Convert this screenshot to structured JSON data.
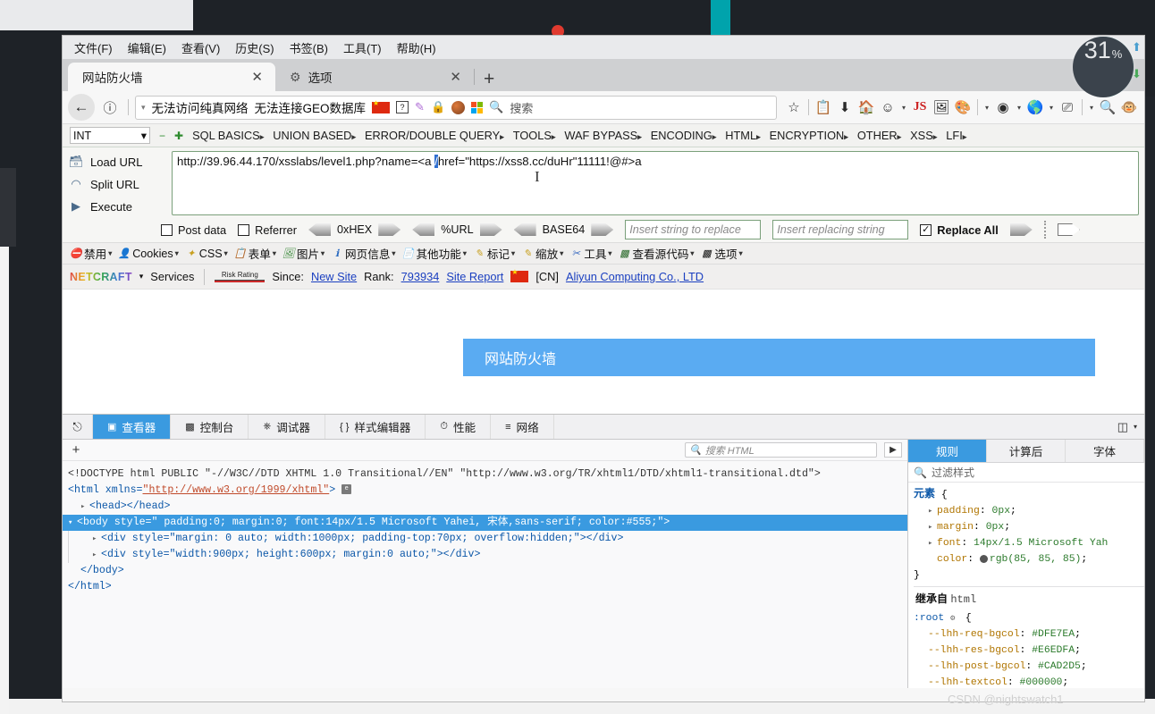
{
  "desktop": {
    "zoom_badge": {
      "value": "31",
      "unit": "%"
    },
    "watermark": "CSDN @nightswatch1"
  },
  "menubar": [
    {
      "label": "文件(F)"
    },
    {
      "label": "编辑(E)"
    },
    {
      "label": "查看(V)"
    },
    {
      "label": "历史(S)"
    },
    {
      "label": "书签(B)"
    },
    {
      "label": "工具(T)"
    },
    {
      "label": "帮助(H)"
    }
  ],
  "tabs": {
    "active": {
      "title": "网站防火墙",
      "close": "✕"
    },
    "second": {
      "title": "选项",
      "close": "✕",
      "icon": "gear-icon"
    },
    "new_tab": "+"
  },
  "navbar": {
    "back": "←",
    "info_icon": "ⓘ",
    "dropdown_caret": "▾",
    "status_text_1": "无法访问纯真网络",
    "status_text_2": "无法连接GEO数据库",
    "search_placeholder": "搜索",
    "icons": [
      "flag-cn-icon",
      "unknown-icon",
      "pen-icon",
      "lock-icon",
      "globe-icon",
      "microsoft-icon",
      "search-icon"
    ],
    "right_icons": [
      "bookmark-star-icon",
      "library-icon",
      "download-icon",
      "home-icon",
      "account-icon",
      "js-icon",
      "screenshot-icon",
      "palette-icon",
      "hackbar-icon",
      "firefox-icon",
      "container-icon",
      "zoom-icon",
      "monkey-icon"
    ]
  },
  "hackbar": {
    "select_value": "INT",
    "minus": "−",
    "plus": "✚",
    "menus": [
      {
        "label": "SQL BASICS"
      },
      {
        "label": "UNION BASED"
      },
      {
        "label": "ERROR/DOUBLE QUERY"
      },
      {
        "label": "TOOLS"
      },
      {
        "label": "WAF BYPASS"
      },
      {
        "label": "ENCODING"
      },
      {
        "label": "HTML"
      },
      {
        "label": "ENCRYPTION"
      },
      {
        "label": "OTHER"
      },
      {
        "label": "XSS"
      },
      {
        "label": "LFI"
      }
    ],
    "actions": [
      {
        "label": "Load URL",
        "icon": "load-icon"
      },
      {
        "label": "Split URL",
        "icon": "split-icon"
      },
      {
        "label": "Execute",
        "icon": "execute-icon"
      }
    ],
    "url_before": "http://39.96.44.170/xsslabs/level1.php?name=<a ",
    "url_selected": "/",
    "url_after": "href=\"https://xss8.cc/duHr\"11111!@#>a",
    "options": {
      "post_data": "Post data",
      "referrer": "Referrer",
      "hex": "0xHEX",
      "url_enc": "%URL",
      "base64": "BASE64",
      "replace_search_placeholder": "Insert string to replace",
      "replace_with_placeholder": "Insert replacing string",
      "replace_all": "Replace All",
      "checked_mark": "✓"
    }
  },
  "webdev_toolbar": [
    {
      "label": "禁用",
      "icon": "disable-icon"
    },
    {
      "label": "Cookies",
      "icon": "cookie-icon"
    },
    {
      "label": "CSS",
      "icon": "css-icon"
    },
    {
      "label": "表单",
      "icon": "form-icon"
    },
    {
      "label": "图片",
      "icon": "image-icon"
    },
    {
      "label": "网页信息",
      "icon": "info-icon"
    },
    {
      "label": "其他功能",
      "icon": "misc-icon"
    },
    {
      "label": "标记",
      "icon": "outline-icon"
    },
    {
      "label": "缩放",
      "icon": "resize-icon"
    },
    {
      "label": "工具",
      "icon": "tools-icon"
    },
    {
      "label": "查看源代码",
      "icon": "source-icon"
    },
    {
      "label": "选项",
      "icon": "options-icon"
    }
  ],
  "netcraft": {
    "logo": "NETCRAFT",
    "services": "Services",
    "risk_rating": "Risk Rating",
    "since_label": "Since:",
    "since_value": "New Site",
    "rank_label": "Rank:",
    "rank_value": "793934",
    "site_report": "Site Report",
    "country": "[CN]",
    "host": "Aliyun Computing Co., LTD"
  },
  "page": {
    "banner_title": "网站防火墙"
  },
  "devtools": {
    "tabs": [
      {
        "label": "查看器",
        "icon": "inspector-icon",
        "active": true
      },
      {
        "label": "控制台",
        "icon": "console-icon",
        "active": false
      },
      {
        "label": "调试器",
        "icon": "debugger-icon",
        "active": false
      },
      {
        "label": "样式编辑器",
        "icon": "style-editor-icon",
        "active": false
      },
      {
        "label": "性能",
        "icon": "performance-icon",
        "active": false
      },
      {
        "label": "网络",
        "icon": "network-icon",
        "active": false
      }
    ],
    "picker_icon": "element-picker-icon",
    "layout_icon": "panel-layout-icon",
    "add_node": "+",
    "search_placeholder": "搜索 HTML",
    "markup": {
      "doctype": "<!DOCTYPE html PUBLIC \"-//W3C//DTD XHTML 1.0 Transitional//EN\" \"http://www.w3.org/TR/xhtml1/DTD/xhtml1-transitional.dtd\">",
      "html_open_a": "<html xmlns=",
      "html_link": "\"http://www.w3.org/1999/xhtml\"",
      "html_open_b": ">",
      "head": "<head></head>",
      "body_sel": "<body style=\" padding:0; margin:0; font:14px/1.5 Microsoft Yahei, 宋体,sans-serif; color:#555;\">",
      "div1": "<div style=\"margin: 0 auto; width:1000px; padding-top:70px; overflow:hidden;\"></div>",
      "div2": "<div style=\"width:900px; height:600px; margin:0 auto;\"></div>",
      "body_close": "</body>",
      "html_close": "</html>"
    },
    "css_panel": {
      "tabs": [
        {
          "label": "规则",
          "active": true
        },
        {
          "label": "计算后",
          "active": false
        },
        {
          "label": "字体",
          "active": false
        }
      ],
      "filter_placeholder": "过滤样式",
      "element_rule_selector": "元素",
      "element_rule_props": [
        {
          "name": "padding",
          "value": "0px"
        },
        {
          "name": "margin",
          "value": "0px"
        },
        {
          "name": "font",
          "value": "14px/1.5 Microsoft Yah"
        },
        {
          "name": "color",
          "value": "rgb(85, 85, 85)",
          "swatch": "#555555"
        }
      ],
      "inherit_label": "继承自",
      "inherit_from": "html",
      "root_selector": ":root",
      "root_props": [
        {
          "name": "--lhh-req-bgcol",
          "value": "#DFE7EA"
        },
        {
          "name": "--lhh-res-bgcol",
          "value": "#E6EDFA"
        },
        {
          "name": "--lhh-post-bgcol",
          "value": "#CAD2D5"
        },
        {
          "name": "--lhh-textcol",
          "value": "#000000"
        }
      ]
    }
  }
}
